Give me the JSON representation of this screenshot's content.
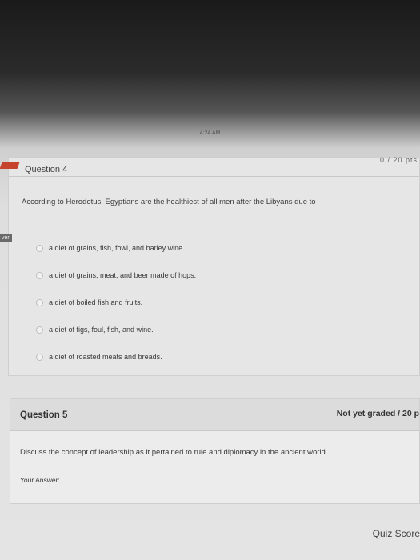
{
  "status": {
    "time": "4:24 AM"
  },
  "question4": {
    "title": "Question 4",
    "points": "0 / 20 pts",
    "text": "According to Herodotus, Egyptians are the healthiest of all men after the Libyans due to",
    "answer_tag": "ver",
    "options": [
      "a diet of grains, fish, fowl, and barley wine.",
      "a diet of grains, meat, and beer made of hops.",
      "a diet of boiled fish and fruits.",
      "a diet of figs, foul, fish, and wine.",
      "a diet of roasted meats and breads."
    ]
  },
  "question5": {
    "title": "Question 5",
    "grade": "Not yet graded / 20 p",
    "text": "Discuss the concept of leadership as it pertained to rule and diplomacy in the ancient world.",
    "answer_label": "Your Answer:"
  },
  "footer": {
    "quiz_score": "Quiz Score"
  }
}
